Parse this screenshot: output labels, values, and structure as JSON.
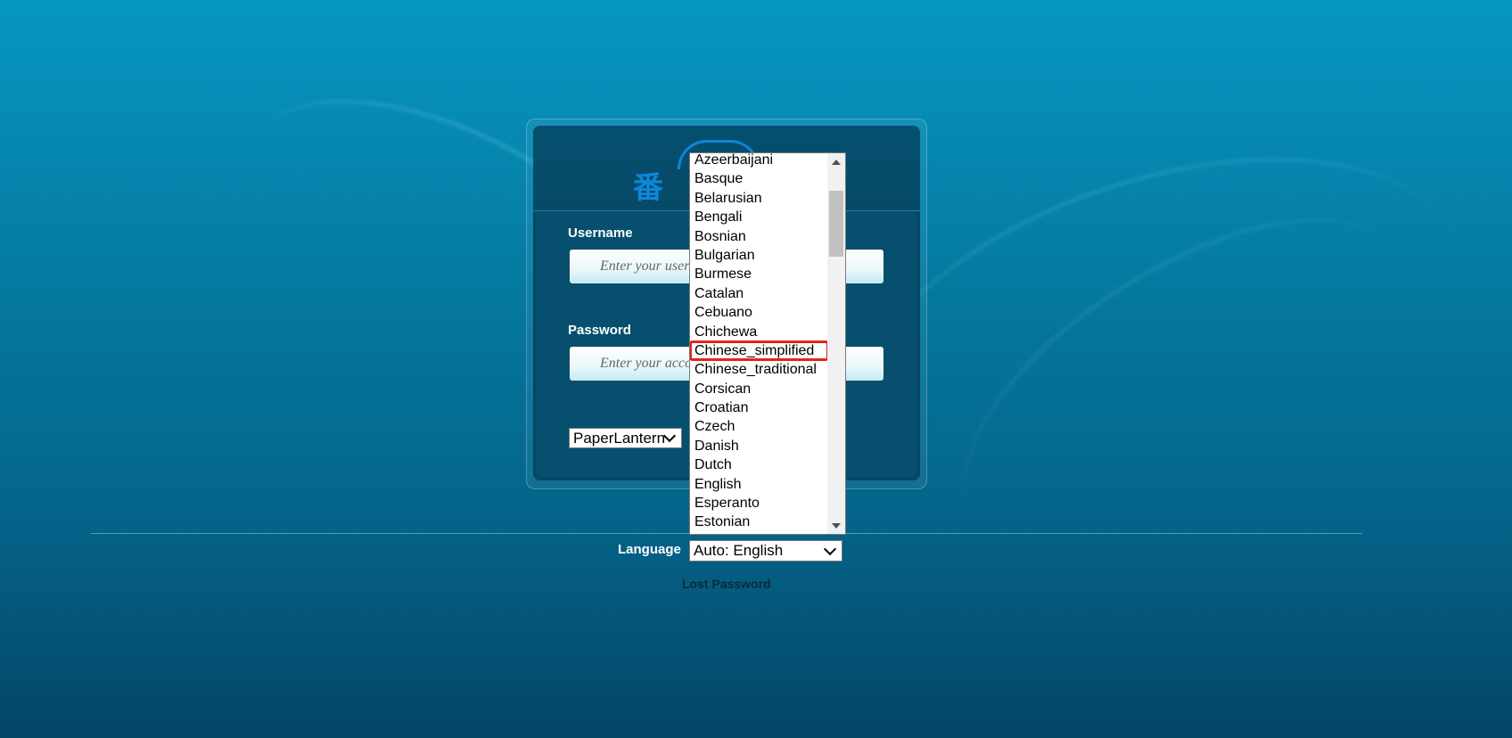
{
  "login": {
    "logo_text": "番",
    "username_label": "Username",
    "username_placeholder": "Enter your username.",
    "password_label": "Password",
    "password_placeholder": "Enter your account password.",
    "theme_selected": "PaperLantern"
  },
  "footer": {
    "language_label": "Language",
    "language_selected": "Auto: English",
    "lost_password": "Lost Password"
  },
  "language_options": [
    "Azeerbaijani",
    "Basque",
    "Belarusian",
    "Bengali",
    "Bosnian",
    "Bulgarian",
    "Burmese",
    "Catalan",
    "Cebuano",
    "Chichewa",
    "Chinese_simplified",
    "Chinese_traditional",
    "Corsican",
    "Croatian",
    "Czech",
    "Danish",
    "Dutch",
    "English",
    "Esperanto",
    "Estonian"
  ],
  "highlighted_option": "Chinese_simplified",
  "colors": {
    "highlight_outline": "#e8231a",
    "logo_blue": "#0d87d6",
    "panel": "#064f6e"
  }
}
